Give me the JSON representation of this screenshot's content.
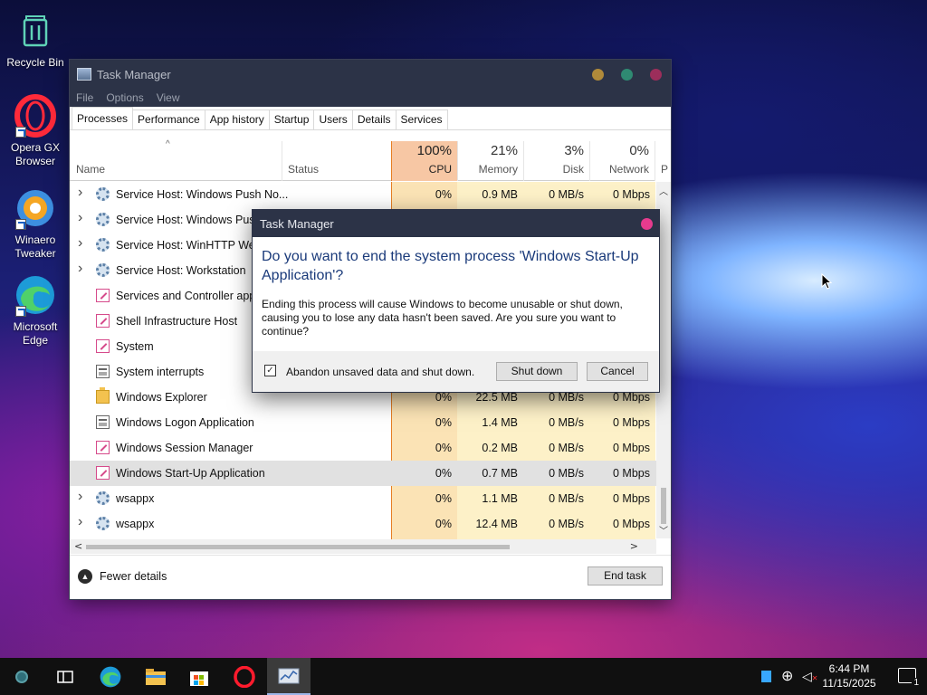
{
  "desktop": {
    "icons": [
      {
        "label": "Recycle Bin",
        "icon": "recycle-bin-icon"
      },
      {
        "label": "Opera GX Browser",
        "icon": "opera-gx-icon"
      },
      {
        "label": "Winaero Tweaker",
        "icon": "winaero-tweaker-icon"
      },
      {
        "label": "Microsoft Edge",
        "icon": "edge-icon"
      }
    ]
  },
  "taskmanager": {
    "title": "Task Manager",
    "menu": [
      "File",
      "Options",
      "View"
    ],
    "tabs": [
      "Processes",
      "Performance",
      "App history",
      "Startup",
      "Users",
      "Details",
      "Services"
    ],
    "active_tab": "Processes",
    "columns": {
      "name": "Name",
      "status": "Status",
      "cpu": {
        "pct": "100%",
        "label": "CPU"
      },
      "memory": {
        "pct": "21%",
        "label": "Memory"
      },
      "disk": {
        "pct": "3%",
        "label": "Disk"
      },
      "network": {
        "pct": "0%",
        "label": "Network"
      },
      "power_partial": "P"
    },
    "rows": [
      {
        "name": "Service Host: Windows Push No...",
        "icon": "gear-icon",
        "expandable": true,
        "cpu": "0%",
        "memory": "0.9 MB",
        "disk": "0 MB/s",
        "network": "0 Mbps"
      },
      {
        "name": "Service Host: Windows Push",
        "icon": "gear-icon",
        "expandable": true,
        "cpu": "",
        "memory": "",
        "disk": "",
        "network": ""
      },
      {
        "name": "Service Host: WinHTTP Web",
        "icon": "gear-icon",
        "expandable": true,
        "cpu": "",
        "memory": "",
        "disk": "",
        "network": ""
      },
      {
        "name": "Service Host: Workstation",
        "icon": "gear-icon",
        "expandable": true,
        "cpu": "",
        "memory": "",
        "disk": "",
        "network": ""
      },
      {
        "name": "Services and Controller app",
        "icon": "pen-icon",
        "expandable": false,
        "cpu": "",
        "memory": "",
        "disk": "",
        "network": ""
      },
      {
        "name": "Shell Infrastructure Host",
        "icon": "pen-icon",
        "expandable": false,
        "cpu": "",
        "memory": "",
        "disk": "",
        "network": ""
      },
      {
        "name": "System",
        "icon": "pen-icon",
        "expandable": false,
        "cpu": "",
        "memory": "",
        "disk": "",
        "network": ""
      },
      {
        "name": "System interrupts",
        "icon": "window-icon",
        "expandable": false,
        "cpu": "",
        "memory": "",
        "disk": "",
        "network": ""
      },
      {
        "name": "Windows Explorer",
        "icon": "folder-icon",
        "expandable": false,
        "cpu": "0%",
        "memory": "22.5 MB",
        "disk": "0 MB/s",
        "network": "0 Mbps"
      },
      {
        "name": "Windows Logon Application",
        "icon": "window-icon",
        "expandable": false,
        "cpu": "0%",
        "memory": "1.4 MB",
        "disk": "0 MB/s",
        "network": "0 Mbps"
      },
      {
        "name": "Windows Session Manager",
        "icon": "pen-icon",
        "expandable": false,
        "cpu": "0%",
        "memory": "0.2 MB",
        "disk": "0 MB/s",
        "network": "0 Mbps"
      },
      {
        "name": "Windows Start-Up Application",
        "icon": "pen-icon",
        "expandable": false,
        "selected": true,
        "cpu": "0%",
        "memory": "0.7 MB",
        "disk": "0 MB/s",
        "network": "0 Mbps"
      },
      {
        "name": "wsappx",
        "icon": "gear-icon",
        "expandable": true,
        "cpu": "0%",
        "memory": "1.1 MB",
        "disk": "0 MB/s",
        "network": "0 Mbps"
      },
      {
        "name": "wsappx",
        "icon": "gear-icon",
        "expandable": true,
        "cpu": "0%",
        "memory": "12.4 MB",
        "disk": "0 MB/s",
        "network": "0 Mbps"
      }
    ],
    "footer": {
      "fewer_details": "Fewer details",
      "end_task": "End task"
    }
  },
  "dialog": {
    "title": "Task Manager",
    "heading": "Do you want to end the system process 'Windows Start-Up Application'?",
    "body": "Ending this process will cause Windows to become unusable or shut down, causing you to lose any data hasn't been saved. Are you sure you want to continue?",
    "checkbox_label": "Abandon unsaved data and shut down.",
    "checkbox_checked": true,
    "shutdown_label": "Shut down",
    "cancel_label": "Cancel"
  },
  "taskbar": {
    "apps": [
      "start-icon",
      "task-view-icon",
      "edge-icon",
      "file-explorer-icon",
      "store-icon",
      "opera-icon",
      "task-manager-icon"
    ],
    "time": "6:44 PM",
    "date": "11/15/2025",
    "notification_count": "1"
  },
  "colors": {
    "accent_title": "#2c3347",
    "cpu_bg": "#fbe3b5",
    "col_bg": "#fdf1c8",
    "dialog_close": "#e63b8e"
  }
}
